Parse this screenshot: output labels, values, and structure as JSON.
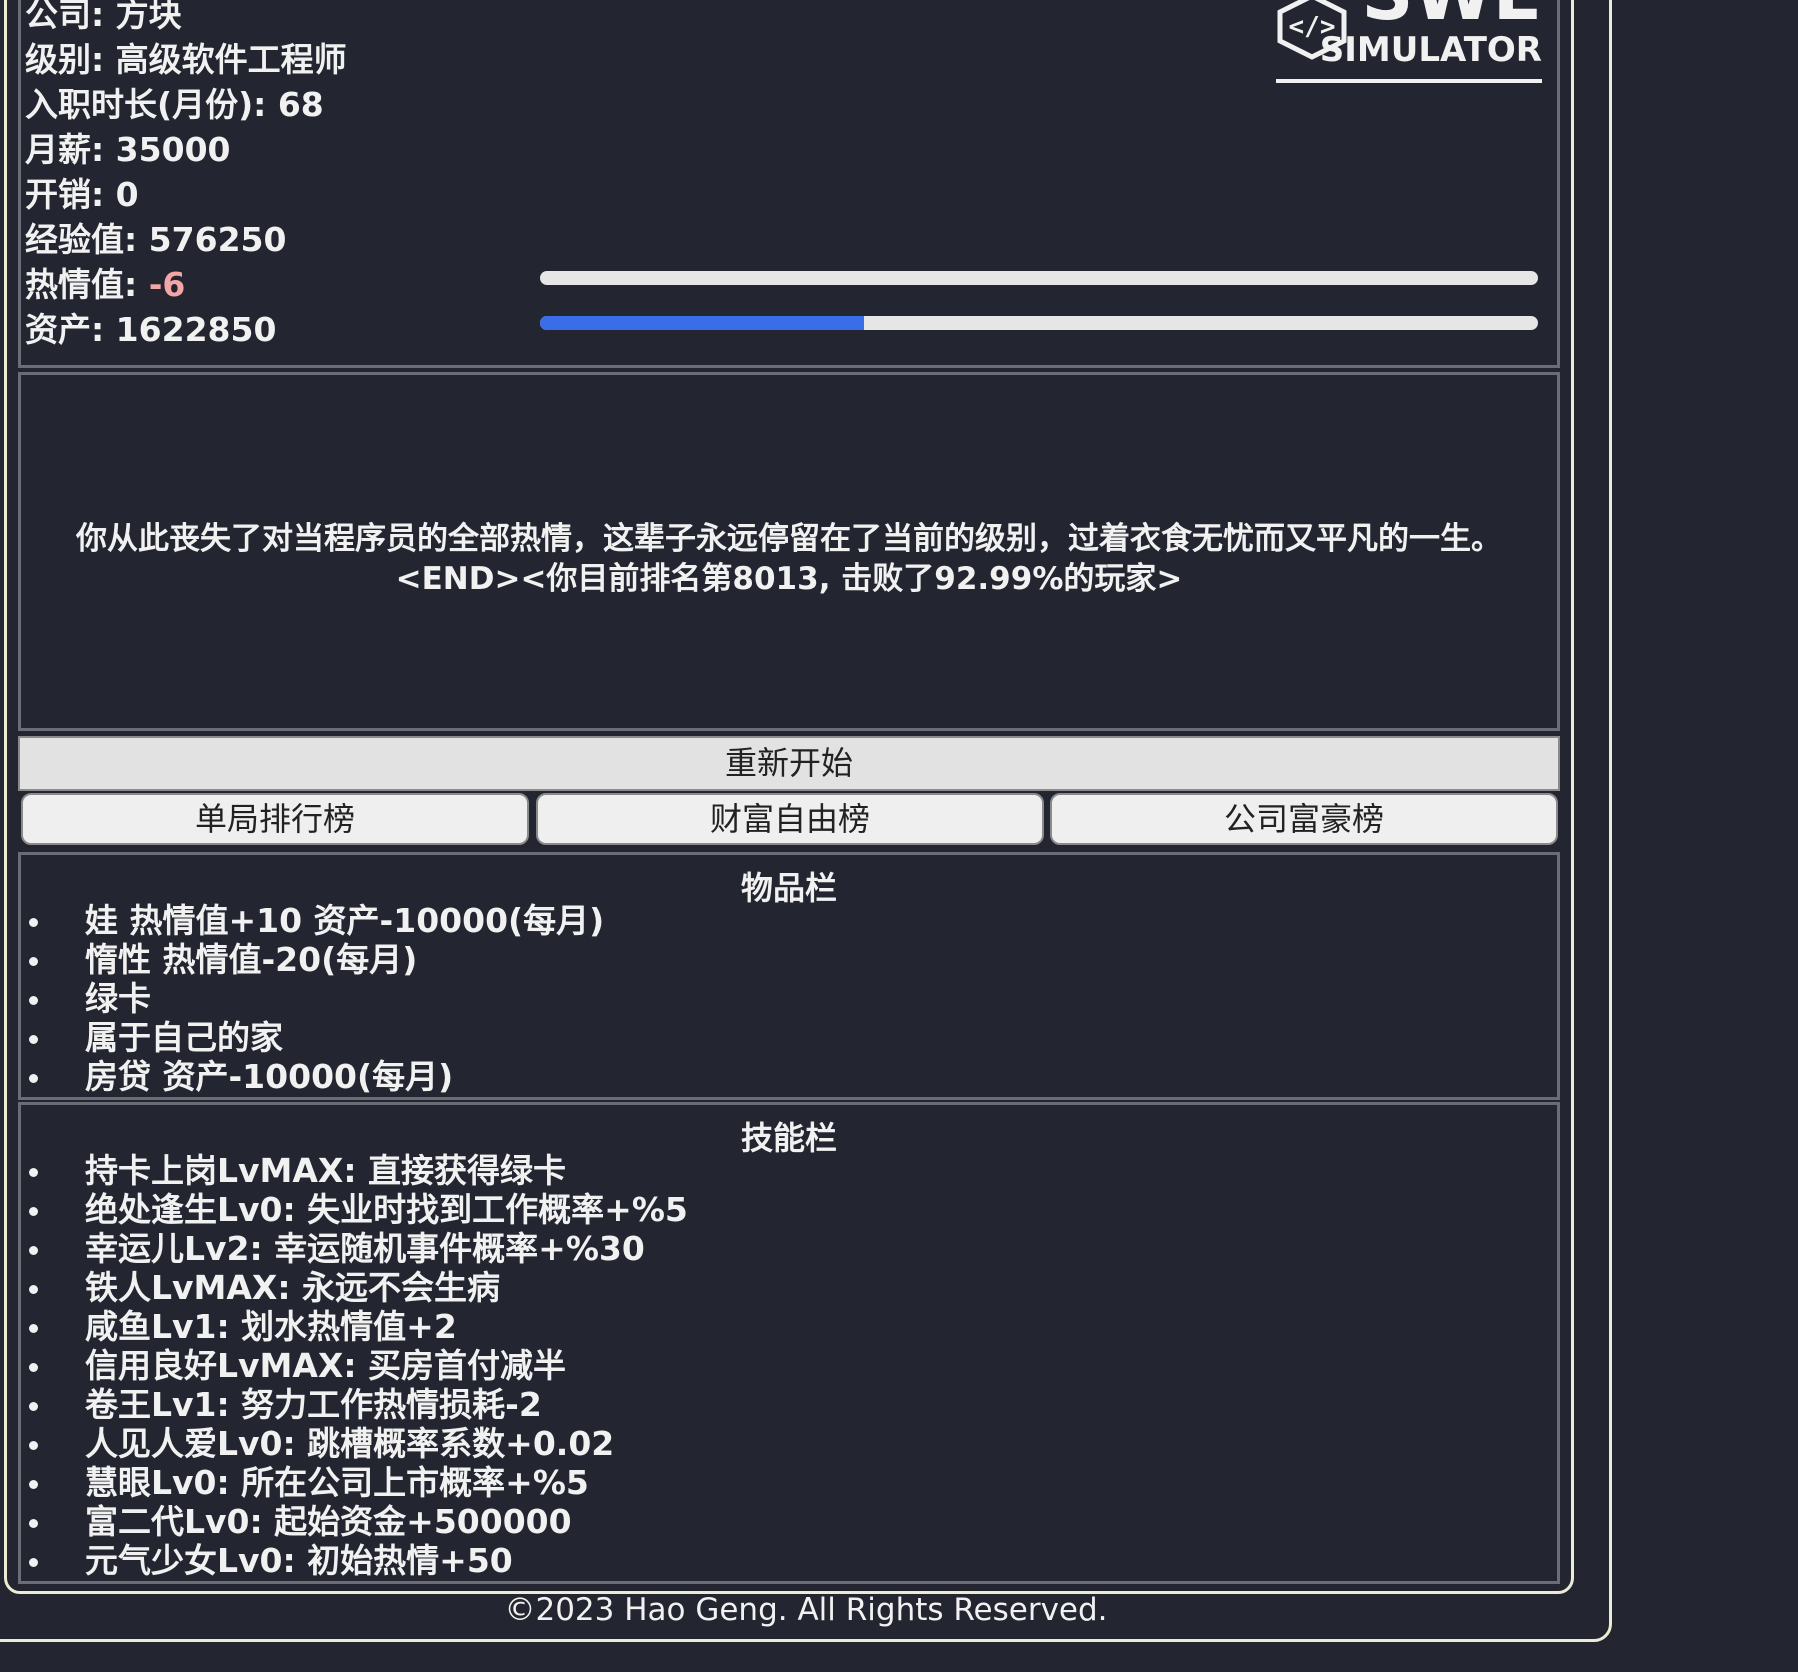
{
  "stats": {
    "company": "公司: 方块",
    "level": "级别: 高级软件工程师",
    "tenure": "入职时长(月份): 68",
    "salary": "月薪: 35000",
    "expense": "开销: 0",
    "experience": "经验值: 576250",
    "passion_label": "热情值: ",
    "passion_value": "-6",
    "assets": "资产: 1622850",
    "passion_bar_fraction": 0.0,
    "assets_bar_fraction": 0.325
  },
  "logo": {
    "text_big": "SWE",
    "text_small": "SIMULATOR",
    "glyph": "</>"
  },
  "message": {
    "line1": "你从此丧失了对当程序员的全部热情，这辈子永远停留在了当前的级别，过着衣食无忧而又平凡的一生。",
    "line2": "<END><你目前排名第8013, 击败了92.99%的玩家>"
  },
  "buttons": {
    "restart": "重新开始",
    "single_rank": "单局排行榜",
    "wealth_rank": "财富自由榜",
    "company_rank": "公司富豪榜"
  },
  "items": {
    "title": "物品栏",
    "list": [
      "娃 热情值+10 资产-10000(每月)",
      "惰性 热情值-20(每月)",
      "绿卡",
      "属于自己的家",
      "房贷 资产-10000(每月)"
    ]
  },
  "skills": {
    "title": "技能栏",
    "list": [
      "持卡上岗LvMAX: 直接获得绿卡",
      "绝处逢生Lv0: 失业时找到工作概率+%5",
      "幸运儿Lv2: 幸运随机事件概率+%30",
      "铁人LvMAX: 永远不会生病",
      "咸鱼Lv1: 划水热情值+2",
      "信用良好LvMAX: 买房首付减半",
      "卷王Lv1: 努力工作热情损耗-2",
      "人见人爱Lv0: 跳槽概率系数+0.02",
      "慧眼Lv0: 所在公司上市概率+%5",
      "富二代Lv0: 起始资金+500000",
      "元气少女Lv0: 初始热情+50"
    ]
  },
  "footer": "©2023 Hao Geng. All Rights Reserved.",
  "colors": {
    "background": "#232630",
    "frame": "#ecebd6",
    "bar_fill": "#3a6ee8",
    "negative": "#f2a6a6"
  }
}
